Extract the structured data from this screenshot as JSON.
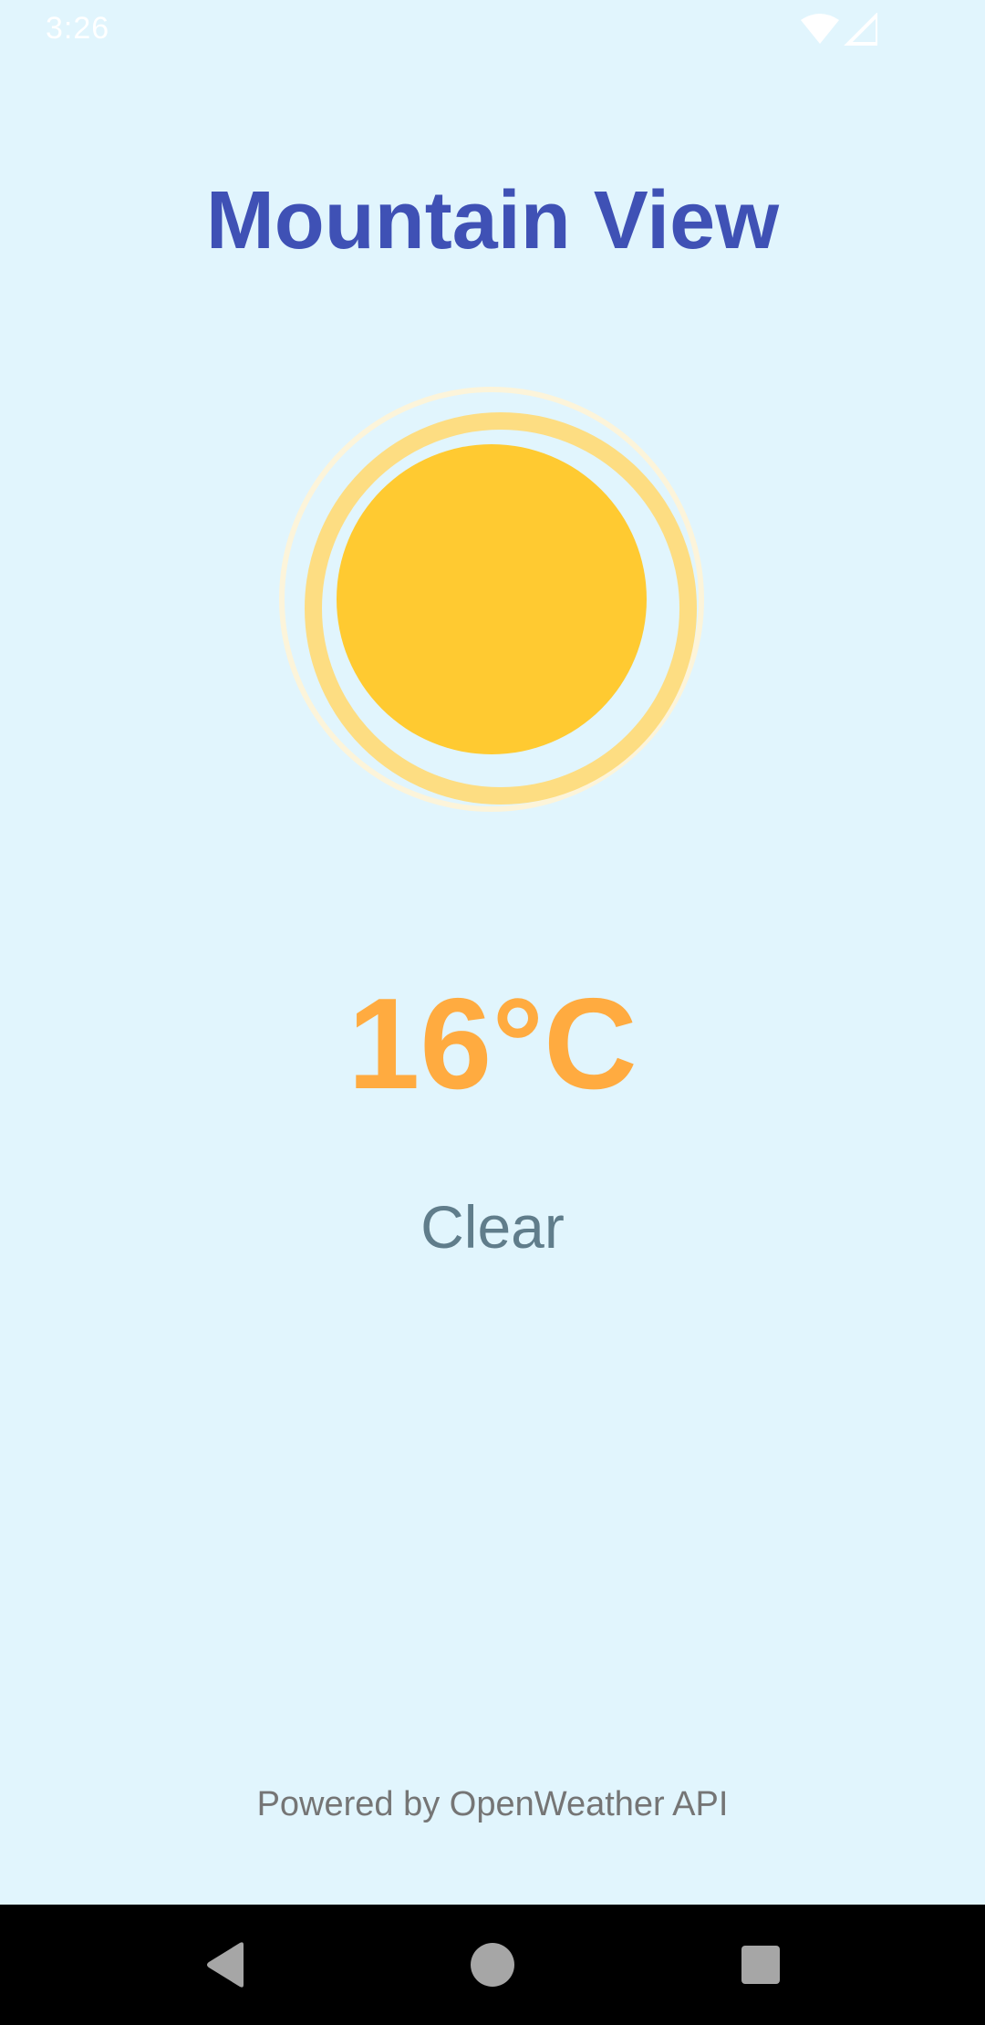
{
  "status_bar": {
    "time": "3:26",
    "icons": [
      "wifi-icon",
      "cell-signal-icon"
    ]
  },
  "weather": {
    "city": "Mountain View",
    "icon": "sun-icon",
    "temperature": "16°C",
    "condition": "Clear"
  },
  "footer": {
    "attribution": "Powered by OpenWeather API"
  },
  "nav_bar": {
    "buttons": [
      "back-icon",
      "home-icon",
      "recents-icon"
    ]
  },
  "colors": {
    "background": "#E1F5FD",
    "title": "#3F51B5",
    "temperature": "#FFAB40",
    "condition": "#607D8B",
    "sun_core": "#FFCA31",
    "sun_ring": "#FDDD82",
    "sun_glow": "#FCF4DA",
    "attribution": "#757575"
  }
}
